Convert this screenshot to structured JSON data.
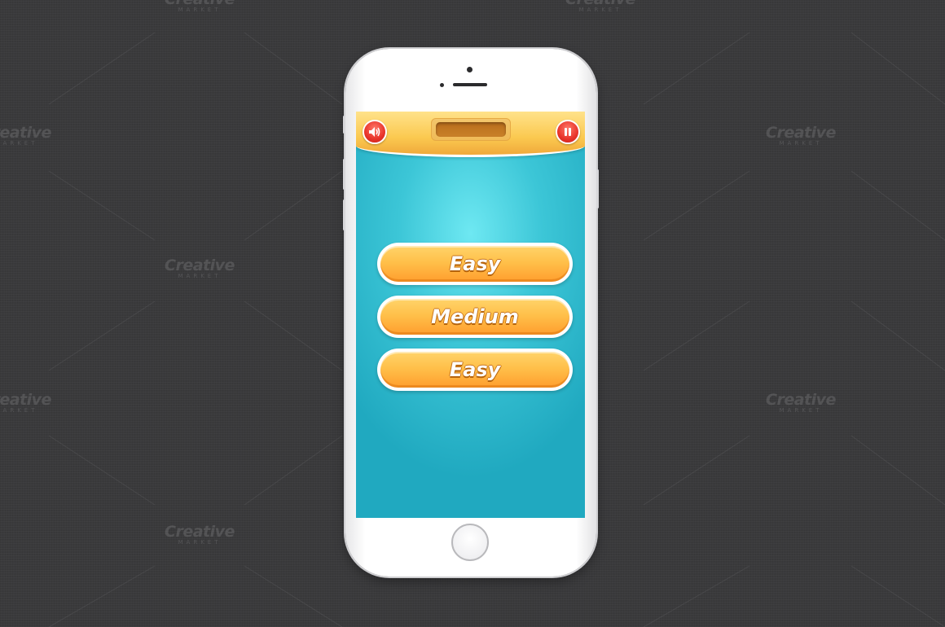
{
  "watermark": {
    "brand": "Creative",
    "sub": "MARKET"
  },
  "game": {
    "top_bar": {
      "sound_icon": "speaker-icon",
      "pause_icon": "pause-icon"
    },
    "difficulty_buttons": [
      {
        "label": "Easy"
      },
      {
        "label": "Medium"
      },
      {
        "label": "Easy"
      }
    ]
  },
  "colors": {
    "background": "#3a3a3c",
    "screen_cyan": "#3cc6d7",
    "button_orange": "#ffc04a",
    "round_button_red": "#e8332a"
  }
}
